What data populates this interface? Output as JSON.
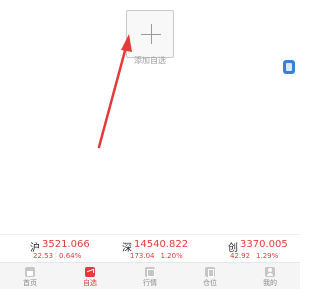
{
  "add_watchlist": {
    "label": "添加自选",
    "icon": "plus-icon"
  },
  "annotation": {
    "type": "arrow",
    "color": "#e33a3a"
  },
  "side_tab": {
    "icon": "floating-tab-icon",
    "color": "#3b7fd6"
  },
  "indices": [
    {
      "market": "沪",
      "value": "3521.066",
      "change": "22.53",
      "percent": "0.64%"
    },
    {
      "market": "深",
      "value": "14540.822",
      "change": "173.04",
      "percent": "1.20%"
    },
    {
      "market": "创",
      "value": "3370.005",
      "change": "42.92",
      "percent": "1.29%"
    }
  ],
  "nav": {
    "items": [
      {
        "label": "首页",
        "icon": "home-icon",
        "active": false
      },
      {
        "label": "自选",
        "icon": "chart-icon",
        "active": true
      },
      {
        "label": "行情",
        "icon": "market-icon",
        "active": false
      },
      {
        "label": "仓位",
        "icon": "position-icon",
        "active": false
      },
      {
        "label": "我的",
        "icon": "profile-icon",
        "active": false
      }
    ]
  },
  "colors": {
    "up": "#e33a3a",
    "accent": "#e33a3a",
    "muted": "#888888"
  }
}
